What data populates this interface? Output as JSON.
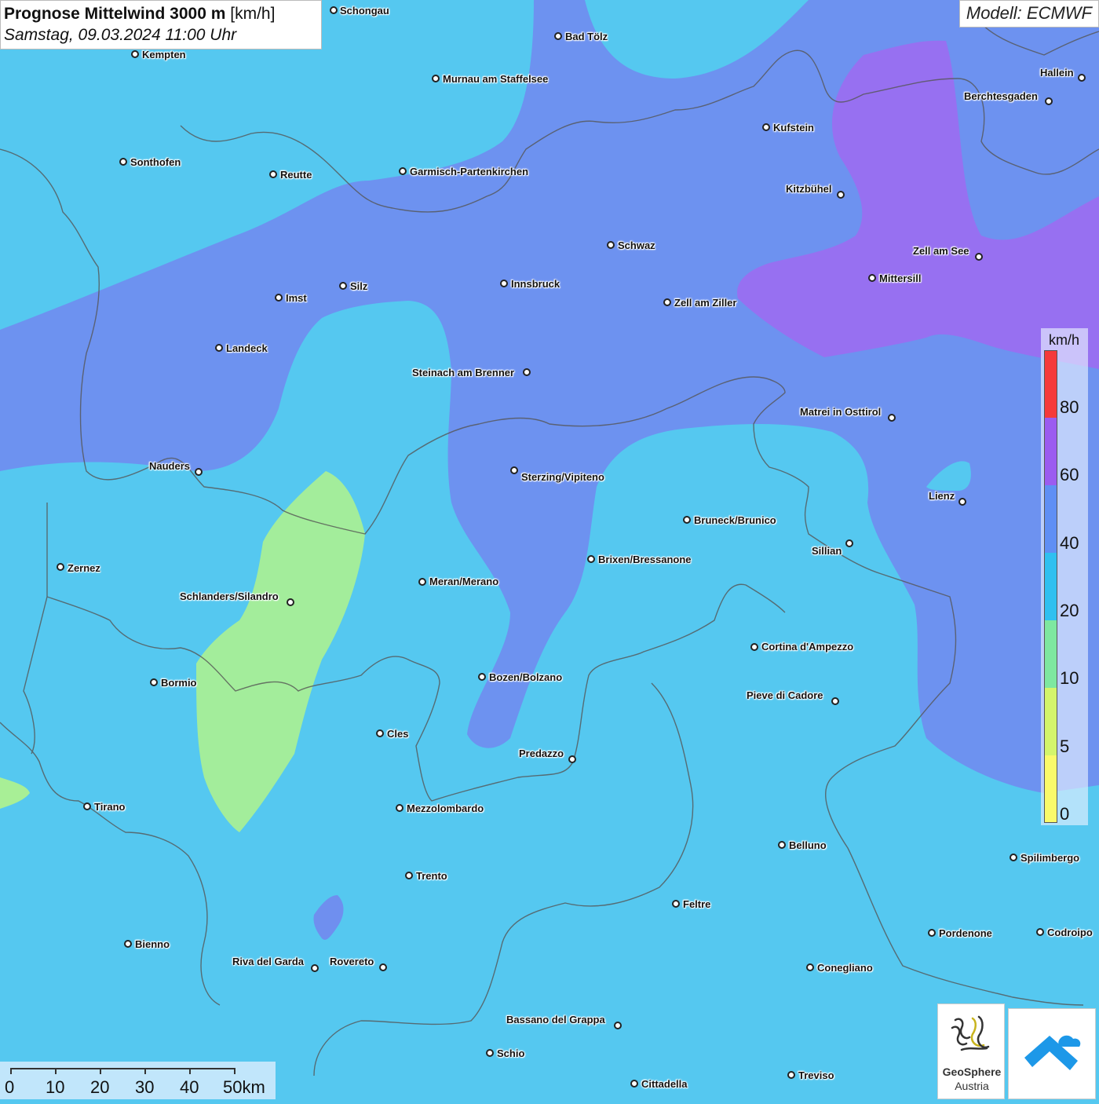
{
  "title": {
    "main": "Prognose Mittelwind 3000 m",
    "unit": "[km/h]",
    "date": "Samstag, 09.03.2024 11:00 Uhr"
  },
  "model": "Modell: ECMWF",
  "legend": {
    "title": "km/h",
    "labels": [
      "80",
      "60",
      "40",
      "20",
      "10",
      "5",
      "0"
    ],
    "colors": [
      "#f53a3a",
      "#9b5cf0",
      "#5f8ff4",
      "#2fc0f0",
      "#7ee8a0",
      "#d4f56b",
      "#fafa6a"
    ]
  },
  "colors": {
    "base": "#55c8f0",
    "band_40": "#6f8fef",
    "band_60": "#9a70ef",
    "band_10": "#a8ef96",
    "border": "#555555"
  },
  "cities": [
    {
      "name": "Schongau"
    },
    {
      "name": "Kempten"
    },
    {
      "name": "Bad Tölz"
    },
    {
      "name": "Murnau am Staffelsee"
    },
    {
      "name": "Hallein"
    },
    {
      "name": "Berchtesgaden"
    },
    {
      "name": "Kufstein"
    },
    {
      "name": "Sonthofen"
    },
    {
      "name": "Reutte"
    },
    {
      "name": "Garmisch-Partenkirchen"
    },
    {
      "name": "Kitzbühel"
    },
    {
      "name": "Schwaz"
    },
    {
      "name": "Zell am See"
    },
    {
      "name": "Innsbruck"
    },
    {
      "name": "Mittersill"
    },
    {
      "name": "Imst"
    },
    {
      "name": "Silz"
    },
    {
      "name": "Zell am Ziller"
    },
    {
      "name": "Landeck"
    },
    {
      "name": "Steinach am Brenner"
    },
    {
      "name": "Matrei in Osttirol"
    },
    {
      "name": "Nauders"
    },
    {
      "name": "Sterzing/Vipiteno"
    },
    {
      "name": "Lienz"
    },
    {
      "name": "Bruneck/Brunico"
    },
    {
      "name": "Sillian"
    },
    {
      "name": "Zernez"
    },
    {
      "name": "Brixen/Bressanone"
    },
    {
      "name": "Meran/Merano"
    },
    {
      "name": "Schlanders/Silandro"
    },
    {
      "name": "Cortina d'Ampezzo"
    },
    {
      "name": "Bozen/Bolzano"
    },
    {
      "name": "Bormio"
    },
    {
      "name": "Pieve di Cadore"
    },
    {
      "name": "Cles"
    },
    {
      "name": "Predazzo"
    },
    {
      "name": "Tirano"
    },
    {
      "name": "Mezzolombardo"
    },
    {
      "name": "Belluno"
    },
    {
      "name": "Spilimbergo"
    },
    {
      "name": "Trento"
    },
    {
      "name": "Feltre"
    },
    {
      "name": "Pordenone"
    },
    {
      "name": "Codroipo"
    },
    {
      "name": "Bienno"
    },
    {
      "name": "Riva del Garda"
    },
    {
      "name": "Rovereto"
    },
    {
      "name": "Conegliano"
    },
    {
      "name": "Bassano del Grappa"
    },
    {
      "name": "Schio"
    },
    {
      "name": "Treviso"
    },
    {
      "name": "Cittadella"
    }
  ],
  "scale": {
    "labels": [
      "0",
      "10",
      "20",
      "30",
      "40",
      "50km"
    ]
  },
  "logos": {
    "geosphere_line1": "GeoSphere",
    "geosphere_line2": "Austria"
  }
}
